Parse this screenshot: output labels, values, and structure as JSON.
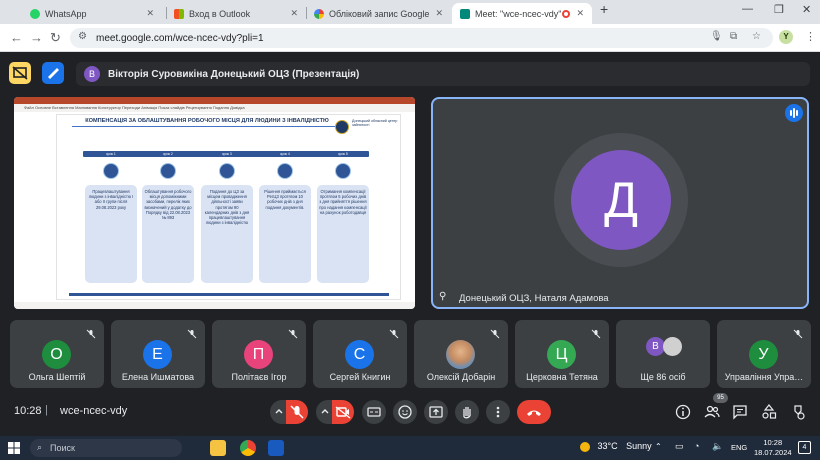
{
  "browser": {
    "tabs": [
      {
        "label": "WhatsApp",
        "fav_color": "#25d366"
      },
      {
        "label": "Вход в Outlook",
        "fav_color": "#f25022"
      },
      {
        "label": "Обліковий запис Google",
        "fav_color": "#4285f4"
      },
      {
        "label": "Meet: \"wce-ncec-vdy\"",
        "fav_color": "#00897b"
      }
    ],
    "url": "meet.google.com/wce-ncec-vdy?pli=1",
    "profile_initial": "Y"
  },
  "meet": {
    "presenter_initial": "В",
    "presenter_text": "Вікторія Суровикіна Донецький ОЦЗ (Презентація)",
    "presentation": {
      "ribbon_text": "Файл  Основне  Вставлення  Малювання  Конструктор  Переходи  Анімація  Показ слайдів  Рецензування  Подання  Довідка",
      "slide_title": "КОМПЕНСАЦІЯ ЗА ОБЛАШТУВАННЯ РОБОЧОГО МІСЦЯ ДЛЯ ЛЮДИНИ З ІНВАЛІДНІСТЮ",
      "org_name": "Донецький обласний центр зайнятості",
      "steps": [
        {
          "label": "крок 1",
          "text": "Працевлаштування людини з інвалідністю І або ІІ групи після 29.08.2023 року"
        },
        {
          "label": "крок 2",
          "text": "Облаштування робочого місця допоміжними засобами, перелік яких визначений у додатку до Порядку від 22.08.2023 № 893"
        },
        {
          "label": "крок 3",
          "text": "Подання до ЦЗ за місцем провадження діяльності заяви протягом 90 календарних днів з дня працевлаштування людини з інвалідністю"
        },
        {
          "label": "крок 4",
          "text": "Рішення приймається РегЦЗ протягом 10 робочих днів з дня подання документів."
        },
        {
          "label": "крок 5",
          "text": "Отримання компенсації протягом 5 робочих днів з дня прийняття рішення про надання компенсації на рахунок роботодавця"
        }
      ]
    },
    "camera_tile": {
      "initial": "Д",
      "name": "Донецький ОЦЗ, Наталя Адамова",
      "avatar_color": "#7e57c2"
    },
    "participants": [
      {
        "name": "Ольга Шептій",
        "initial": "О",
        "color": "#1e8e3e"
      },
      {
        "name": "Елена Ишматова",
        "initial": "Е",
        "color": "#1a73e8"
      },
      {
        "name": "Політаєв Ігор",
        "initial": "П",
        "color": "#e8437b"
      },
      {
        "name": "Сергей Книгин",
        "initial": "С",
        "color": "#1a73e8"
      },
      {
        "name": "Олексій Добарін",
        "initial": "",
        "color": "#8a6d4a"
      },
      {
        "name": "Церковна Тетяна",
        "initial": "Ц",
        "color": "#34a853"
      },
      {
        "name": "Ще 86 осіб",
        "initial": "В",
        "color": "#7e57c2"
      },
      {
        "name": "Управління Упра…",
        "initial": "У",
        "color": "#1e8e3e"
      }
    ],
    "bottom": {
      "time": "10:28",
      "meeting_code": "wce-ncec-vdy",
      "people_badge": "95"
    }
  },
  "taskbar": {
    "search_placeholder": "Поиск",
    "temperature": "33°C",
    "weather": "Sunny",
    "lang": "ENG",
    "time": "10:28",
    "date": "18.07.2024",
    "notifications": "4"
  }
}
